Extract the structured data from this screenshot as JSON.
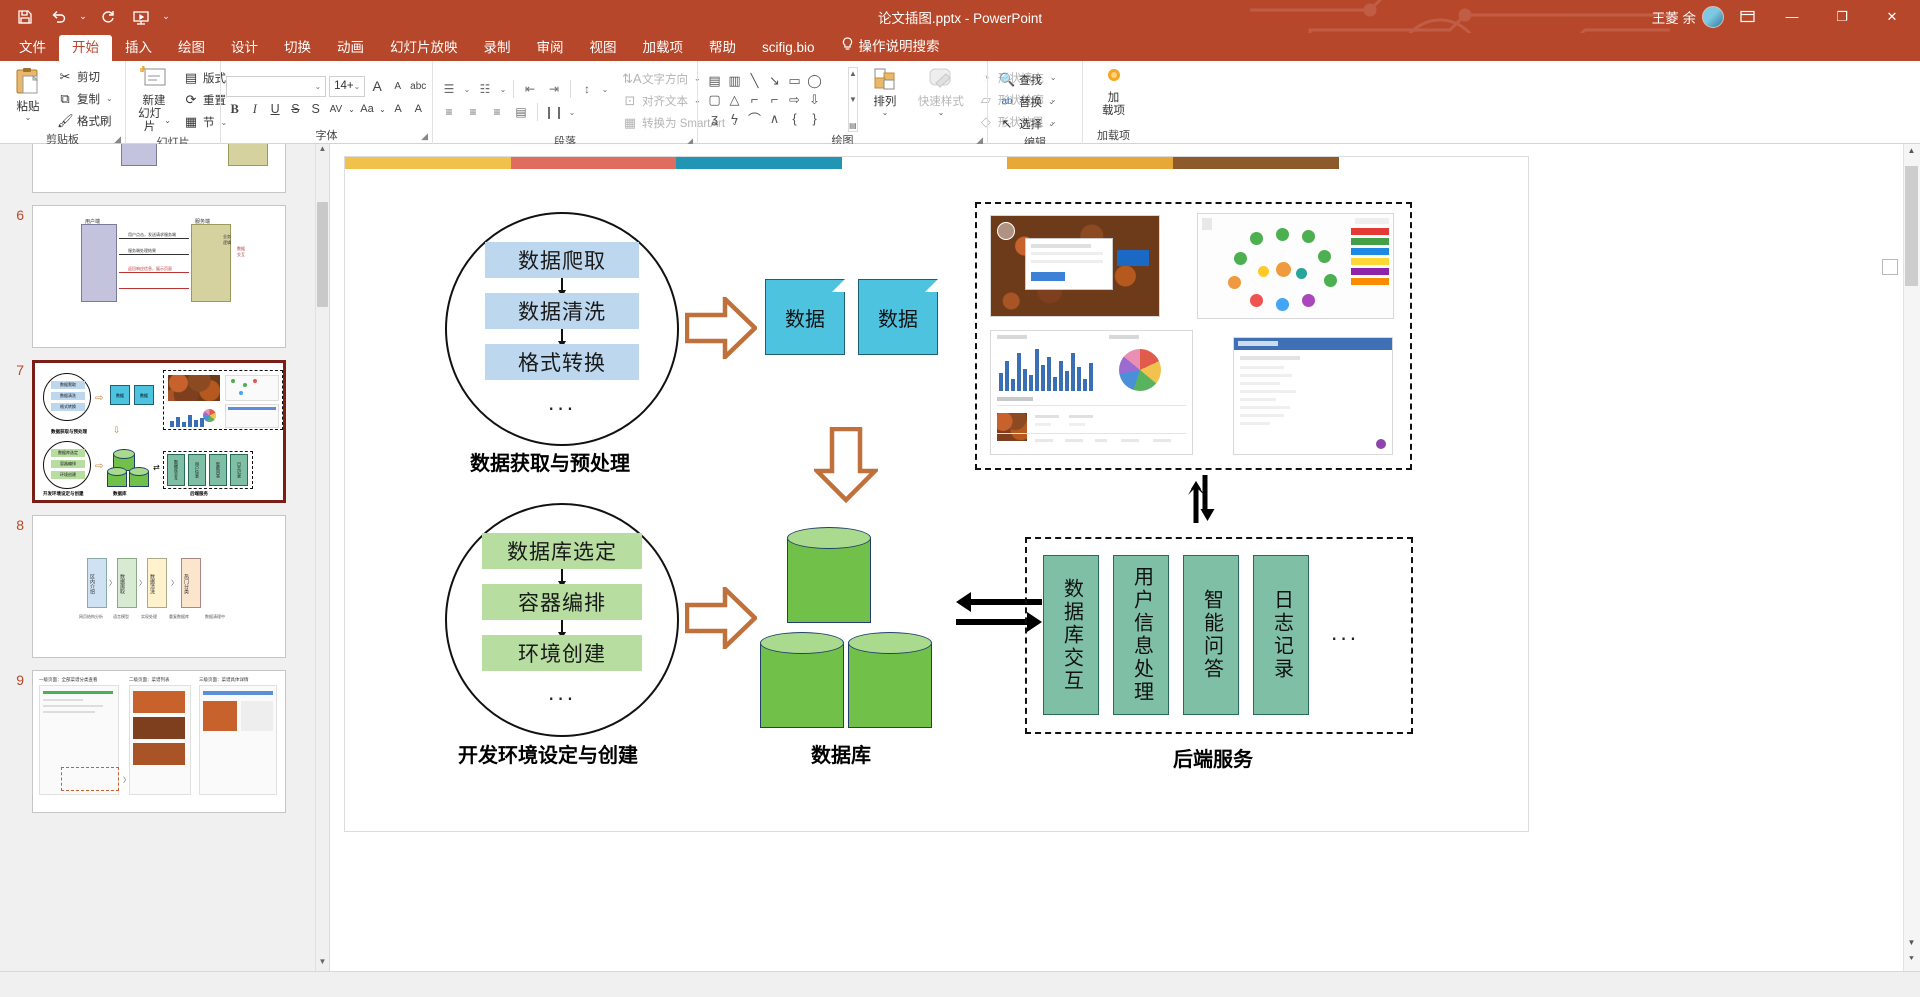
{
  "window": {
    "title": "论文插图.pptx  -  PowerPoint",
    "user_name": "王菱 余",
    "avatar_label": "avatar",
    "ribbon_display_options": "ribbon-display-options-icon",
    "minimize": "—",
    "restore": "❐",
    "close": "✕"
  },
  "quick_access": {
    "save": "save-icon",
    "undo": "undo-icon",
    "undo_more": "⌄",
    "redo": "redo-icon",
    "slideshow": "start-slideshow-icon",
    "customize": "⌄"
  },
  "tabs": [
    {
      "label": "文件",
      "active": false
    },
    {
      "label": "开始",
      "active": true
    },
    {
      "label": "插入",
      "active": false
    },
    {
      "label": "绘图",
      "active": false
    },
    {
      "label": "设计",
      "active": false
    },
    {
      "label": "切换",
      "active": false
    },
    {
      "label": "动画",
      "active": false
    },
    {
      "label": "幻灯片放映",
      "active": false
    },
    {
      "label": "录制",
      "active": false
    },
    {
      "label": "审阅",
      "active": false
    },
    {
      "label": "视图",
      "active": false
    },
    {
      "label": "加载项",
      "active": false
    },
    {
      "label": "帮助",
      "active": false
    },
    {
      "label": "scifig.bio",
      "active": false
    }
  ],
  "tell_me": "操作说明搜索",
  "ribbon": {
    "clipboard": {
      "label": "剪贴板",
      "paste": "粘贴",
      "paste_chev": "⌄",
      "cut": "剪切",
      "copy": "复制",
      "copy_chev": "⌄",
      "format_painter": "格式刷",
      "dialog_launcher": "◢"
    },
    "slides": {
      "label": "幻灯片",
      "new_slide": "新建\n幻灯片",
      "new_slide_line1": "新建",
      "new_slide_line2": "幻灯片",
      "new_slide_chev": "⌄",
      "layout": "版式",
      "reset": "重置",
      "section": "节",
      "chev": "⌄"
    },
    "font": {
      "label": "字体",
      "font_name_value": "",
      "font_name_placeholder": "",
      "font_size_value": "14+",
      "increase_size": "A",
      "decrease_size": "A",
      "clear_format": "abc",
      "bold": "B",
      "italic": "I",
      "underline": "U",
      "strikethrough": "S",
      "shadow": "S",
      "char_spacing": "AV",
      "change_case": "Aa",
      "text_highlight": "A",
      "font_color": "A",
      "chev": "⌄",
      "dialog_launcher": "◢"
    },
    "paragraph": {
      "label": "段落",
      "bullets": "bullet-list-icon",
      "numbering": "numbered-list-icon",
      "decrease_indent": "decrease-indent-icon",
      "increase_indent": "increase-indent-icon",
      "line_spacing": "line-spacing-icon",
      "align_left": "align-left-icon",
      "align_center": "align-center-icon",
      "align_right": "align-right-icon",
      "justify": "justify-icon",
      "columns": "columns-icon",
      "text_direction": "文字方向",
      "align_text": "对齐文本",
      "convert_smartart": "转换为 SmartArt",
      "chev": "⌄",
      "dialog_launcher": "◢"
    },
    "drawing": {
      "label": "绘图",
      "arrange": "排列",
      "quick_styles": "快速样式",
      "shape_fill": "形状填充",
      "shape_outline": "形状轮廓",
      "shape_effects": "形状效果",
      "chev": "⌄",
      "dialog_launcher": "◢",
      "gallery_up": "▲",
      "gallery_down": "▼",
      "gallery_more": "▤"
    },
    "editing": {
      "label": "编辑",
      "find": "查找",
      "replace": "替换",
      "select": "选择",
      "chev": "⌄"
    },
    "addins": {
      "label": "加载项",
      "add_in_line1": "加",
      "add_in_line2": "载项"
    }
  },
  "thumbnails": [
    {
      "number": "6",
      "selected": false
    },
    {
      "number": "7",
      "selected": true
    },
    {
      "number": "8",
      "selected": false
    },
    {
      "number": "9",
      "selected": false
    }
  ],
  "slide": {
    "color_bar": [
      "#f0c14b",
      "#e06c5f",
      "#2196b4",
      "#ffffff",
      "#e8a838",
      "#8c5a2b"
    ],
    "pipeline_top": {
      "steps": [
        "数据爬取",
        "数据清洗",
        "格式转换"
      ],
      "more": "...",
      "caption": "数据获取与预处理",
      "box_color": "#bdd7ee"
    },
    "pipeline_bottom": {
      "steps": [
        "数据库选定",
        "容器编排",
        "环境创建"
      ],
      "more": "...",
      "caption": "开发环境设定与创建",
      "box_color": "#b7dda0"
    },
    "documents": [
      {
        "label": "数据"
      },
      {
        "label": "数据"
      }
    ],
    "database": {
      "caption": "数据库",
      "cylinder_color": "#70c04a"
    },
    "backend": {
      "caption": "后端服务",
      "services": [
        "数据库交互",
        "用户信息处理",
        "智能问答",
        "日志记录"
      ],
      "more": "...",
      "box_color": "#7fbfa5"
    },
    "frontend": {
      "panels": [
        "ui-mock-food-order",
        "ui-mock-knowledge-graph",
        "ui-mock-dashboard",
        "ui-mock-admin"
      ]
    },
    "arrows": {
      "hollow_right_top": "hollow-arrow-right-icon",
      "hollow_down": "hollow-arrow-down-icon",
      "hollow_right_bottom": "hollow-arrow-right-icon",
      "bidirectional_horizontal": "bidirectional-arrow-icon",
      "bidirectional_vertical": "up-down-arrow-icon"
    }
  },
  "canvas_controls": {
    "scroll_up": "▲",
    "scroll_down": "▼",
    "scroll_page_down": "⯆"
  }
}
